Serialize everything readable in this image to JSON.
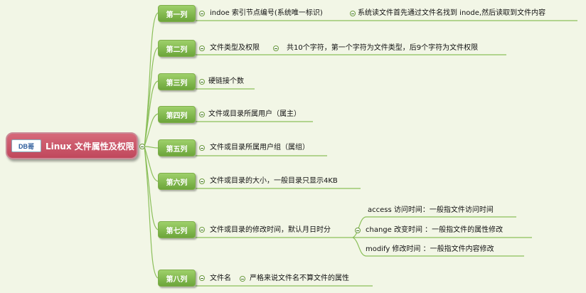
{
  "root": {
    "logo_text": "DB哥",
    "title": "Linux 文件属性及权限"
  },
  "columns": [
    {
      "label": "第一列",
      "desc": "indoe 索引节点编号(系统唯一标识)",
      "sub": "系统读文件首先通过文件名找到 inode,然后读取到文件内容"
    },
    {
      "label": "第二列",
      "desc": "文件类型及权限",
      "sub": "共10个字符，第一个字符为文件类型，后9个字符为文件权限"
    },
    {
      "label": "第三列",
      "desc": "硬链接个数"
    },
    {
      "label": "第四列",
      "desc": "文件或目录所属用户（属主）"
    },
    {
      "label": "第五列",
      "desc": "文件或目录所属用户组（属组）"
    },
    {
      "label": "第六列",
      "desc": "文件或目录的大小，一般目录只显示4KB"
    },
    {
      "label": "第七列",
      "desc": "文件或目录的修改时间，默认月日时分",
      "children": [
        "access 访问时间：一般指文件访问时间",
        "change 改变时间 ：一般指文件的属性修改",
        "modify 修改时间 ：一般指文件内容修改"
      ]
    },
    {
      "label": "第八列",
      "desc": "文件名",
      "sub": "严格来说文件名不算文件的属性"
    }
  ],
  "colors": {
    "line": "#8bbf5a",
    "background": "#f2f6e6",
    "root": "#c8566a",
    "node": "#7fb84a"
  }
}
